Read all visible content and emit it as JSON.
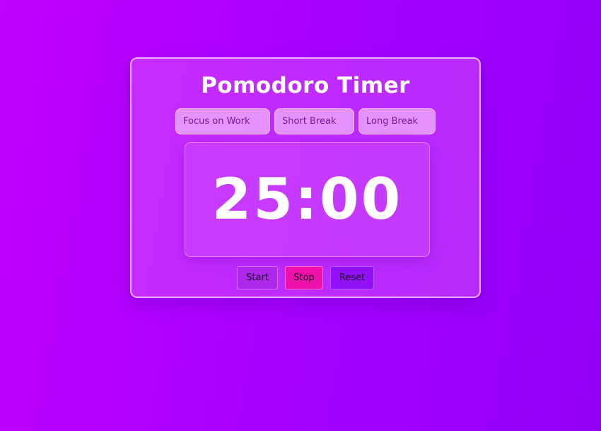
{
  "app": {
    "title": "Pomodoro Timer"
  },
  "modes": [
    {
      "label": "Focus on Work"
    },
    {
      "label": "Short Break"
    },
    {
      "label": "Long Break"
    }
  ],
  "timer": {
    "display": "25:00"
  },
  "controls": {
    "start_label": "Start",
    "stop_label": "Stop",
    "reset_label": "Reset"
  },
  "colors": {
    "background_start": "#c100ff",
    "background_end": "#9300f6",
    "stop_button": "#ee10aa",
    "reset_button": "#9210f6",
    "text": "#ffffff"
  }
}
